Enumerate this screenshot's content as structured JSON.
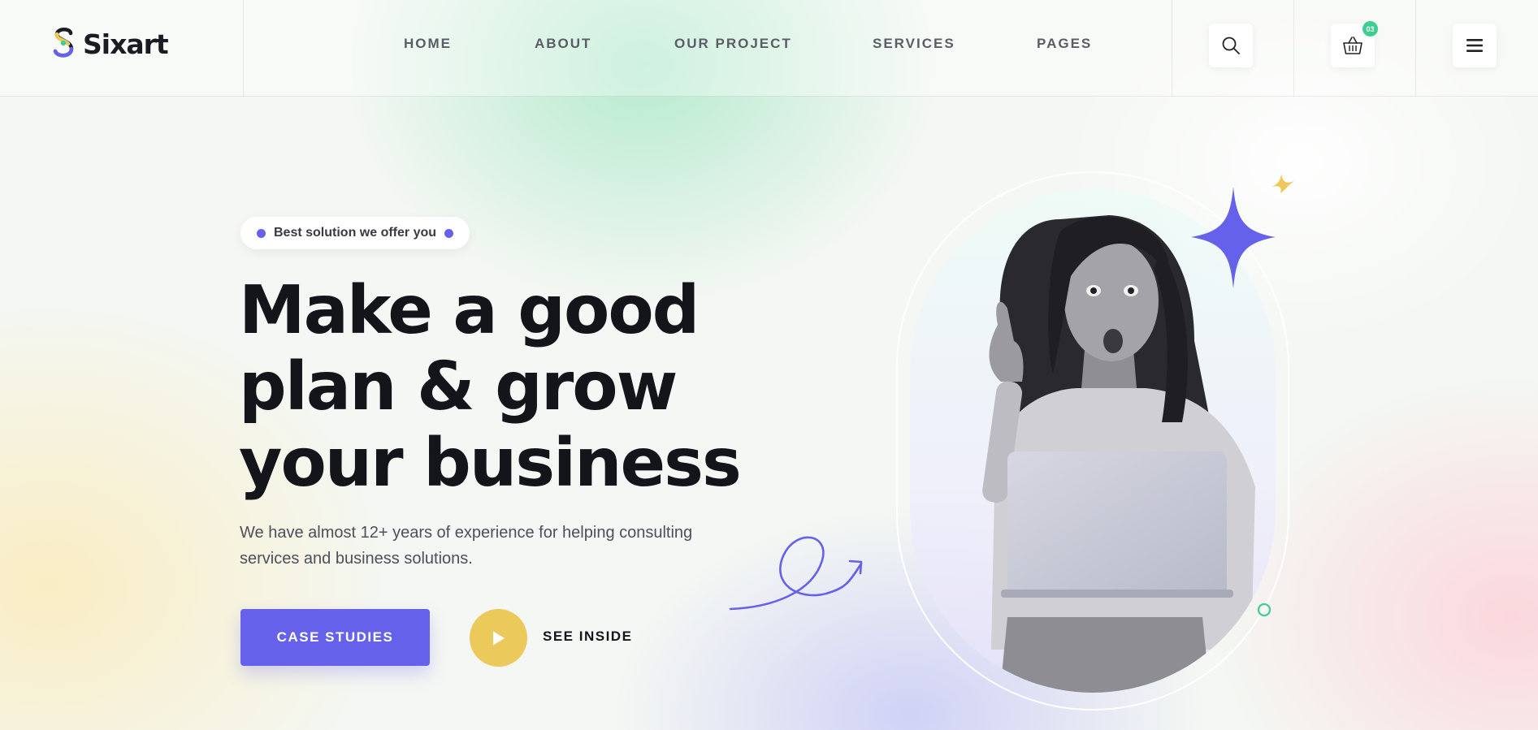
{
  "brand": {
    "name": "Sixart",
    "logo_icon": "sixart-logo-icon",
    "accent": "#6661ea",
    "secondary": "#ecc95b",
    "success": "#3ccf91"
  },
  "nav": {
    "items": [
      {
        "label": "HOME"
      },
      {
        "label": "ABOUT"
      },
      {
        "label": "OUR PROJECT"
      },
      {
        "label": "SERVICES"
      },
      {
        "label": "PAGES"
      }
    ]
  },
  "header_actions": {
    "search_icon": "search-icon",
    "cart_icon": "basket-icon",
    "cart_count": "03",
    "menu_icon": "hamburger-menu-icon"
  },
  "hero": {
    "tagline": "Best solution we offer you",
    "headline_lines": [
      "Make a good",
      "plan & grow",
      "your business"
    ],
    "description": "We have almost 12+ years of experience for helping consulting services and business solutions.",
    "primary_button": "CASE STUDIES",
    "secondary_button": "SEE INSIDE",
    "play_icon": "play-icon",
    "image_subject": "surprised woman holding laptop pointing up"
  }
}
